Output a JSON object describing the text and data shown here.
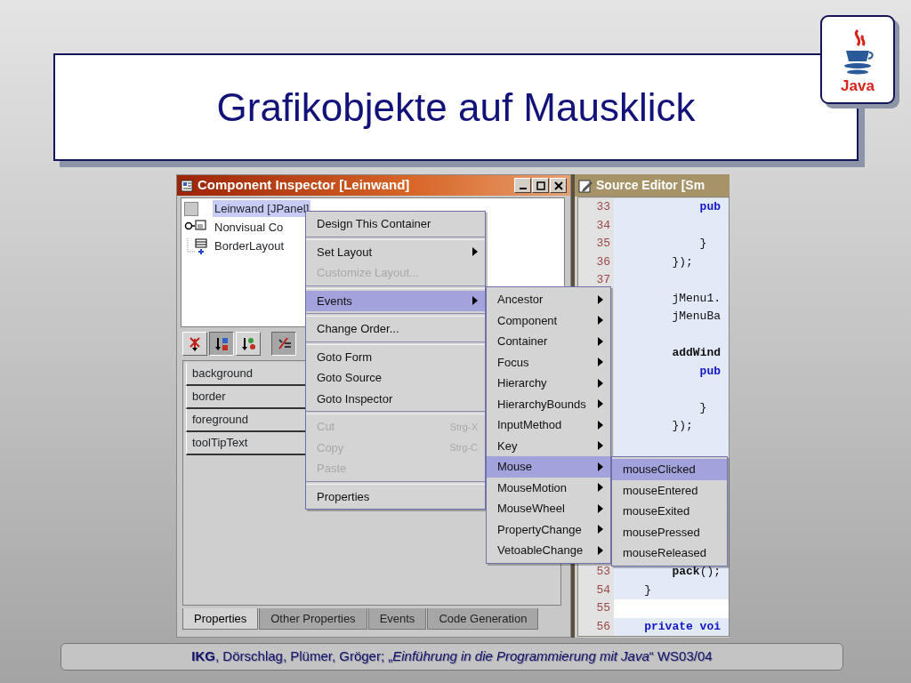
{
  "slide": {
    "title": "Grafikobjekte auf Mausklick",
    "logo_text": "Java",
    "footer": "**IKG**, Dörschlag, Plümer, Gröger; „*Einführung in die Programmierung mit Java*“ WS03/04"
  },
  "inspector": {
    "title": "Component Inspector [Leinwand]",
    "tree": [
      {
        "label": "Leinwand [JPanel]",
        "selected": true,
        "children": [
          {
            "label": "Nonvisual Co",
            "selected": false,
            "kind": "nonvisual"
          },
          {
            "label": "BorderLayout",
            "selected": false,
            "kind": "layout"
          }
        ]
      }
    ],
    "toolbar": [
      {
        "kind": "unsorted",
        "pressed": false
      },
      {
        "kind": "sort-name",
        "pressed": true
      },
      {
        "kind": "sort-type",
        "pressed": false
      },
      {
        "kind": "filter",
        "pressed": true
      }
    ],
    "properties": [
      "background",
      "border",
      "foreground",
      "toolTipText"
    ],
    "tabs": [
      {
        "label": "Properties",
        "selected": true
      },
      {
        "label": "Other Properties",
        "selected": false
      },
      {
        "label": "Events",
        "selected": false
      },
      {
        "label": "Code Generation",
        "selected": false
      }
    ]
  },
  "editor": {
    "title": "Source Editor [Sm",
    "lines": [
      {
        "number": "33",
        "code": "            pub",
        "kind": "keyword",
        "highlighted": true
      },
      {
        "number": "34",
        "highlighted": true
      },
      {
        "number": "35",
        "code": "            }",
        "highlighted": true
      },
      {
        "number": "36",
        "code": "        });",
        "highlighted": true
      },
      {
        "number": "37",
        "highlighted": true
      },
      {
        "code": "        jMenu1.",
        "highlighted": true
      },
      {
        "code": "        jMenuBa",
        "highlighted": true
      },
      {
        "highlighted": true
      },
      {
        "code": "        **addWind**",
        "highlighted": true
      },
      {
        "code": "            pub",
        "kind": "keyword",
        "highlighted": true
      },
      {
        "highlighted": true
      },
      {
        "code": "            }",
        "highlighted": true
      },
      {
        "code": "        });",
        "highlighted": true
      },
      {
        "highlighted": true
      },
      {
        "highlighted": true
      },
      {
        "highlighted": true
      },
      {
        "highlighted": true
      },
      {
        "highlighted": true
      },
      {
        "highlighted": true
      },
      {
        "highlighted": true
      },
      {
        "number": "53",
        "code": "        **pack**();",
        "highlighted": true
      },
      {
        "number": "54",
        "code": "    }",
        "highlighted": true
      },
      {
        "number": "55",
        "highlighted": false
      },
      {
        "number": "56",
        "code": "    private voi",
        "kind": "keyword",
        "highlighted": true
      }
    ]
  },
  "context_menu": {
    "items": [
      {
        "kind": "item",
        "label": "Design This Container",
        "disabled": false,
        "submenu": false,
        "selected": false
      },
      {
        "kind": "separator"
      },
      {
        "kind": "item",
        "label": "Set Layout",
        "disabled": false,
        "submenu": true,
        "selected": false
      },
      {
        "kind": "item",
        "label": "Customize Layout...",
        "disabled": true,
        "submenu": false,
        "selected": false
      },
      {
        "kind": "separator"
      },
      {
        "kind": "item",
        "label": "Events",
        "disabled": false,
        "submenu": true,
        "selected": true
      },
      {
        "kind": "separator"
      },
      {
        "kind": "item",
        "label": "Change Order...",
        "disabled": false,
        "submenu": false,
        "selected": false
      },
      {
        "kind": "separator"
      },
      {
        "kind": "item",
        "label": "Goto Form",
        "disabled": false,
        "submenu": false,
        "selected": false
      },
      {
        "kind": "item",
        "label": "Goto Source",
        "disabled": false,
        "submenu": false,
        "selected": false
      },
      {
        "kind": "item",
        "label": "Goto Inspector",
        "disabled": false,
        "submenu": false,
        "selected": false
      },
      {
        "kind": "separator"
      },
      {
        "kind": "item",
        "label": "Cut",
        "shortcut": "Strg-X",
        "disabled": true,
        "submenu": false,
        "selected": false
      },
      {
        "kind": "item",
        "label": "Copy",
        "shortcut": "Strg-C",
        "disabled": true,
        "submenu": false,
        "selected": false
      },
      {
        "kind": "item",
        "label": "Paste",
        "disabled": true,
        "submenu": false,
        "selected": false
      },
      {
        "kind": "separator"
      },
      {
        "kind": "item",
        "label": "Properties",
        "disabled": false,
        "submenu": false,
        "selected": false
      }
    ]
  },
  "events_menu": {
    "items": [
      {
        "kind": "item",
        "label": "Ancestor",
        "submenu": true,
        "selected": false
      },
      {
        "kind": "item",
        "label": "Component",
        "submenu": true,
        "selected": false
      },
      {
        "kind": "item",
        "label": "Container",
        "submenu": true,
        "selected": false
      },
      {
        "kind": "item",
        "label": "Focus",
        "submenu": true,
        "selected": false
      },
      {
        "kind": "item",
        "label": "Hierarchy",
        "submenu": true,
        "selected": false
      },
      {
        "kind": "item",
        "label": "HierarchyBounds",
        "submenu": true,
        "selected": false
      },
      {
        "kind": "item",
        "label": "InputMethod",
        "submenu": true,
        "selected": false
      },
      {
        "kind": "item",
        "label": "Key",
        "submenu": true,
        "selected": false
      },
      {
        "kind": "item",
        "label": "Mouse",
        "submenu": true,
        "selected": true
      },
      {
        "kind": "item",
        "label": "MouseMotion",
        "submenu": true,
        "selected": false
      },
      {
        "kind": "item",
        "label": "MouseWheel",
        "submenu": true,
        "selected": false
      },
      {
        "kind": "item",
        "label": "PropertyChange",
        "submenu": true,
        "selected": false
      },
      {
        "kind": "item",
        "label": "VetoableChange",
        "submenu": true,
        "selected": false
      }
    ]
  },
  "mouse_menu": {
    "items": [
      {
        "kind": "item",
        "label": "mouseClicked",
        "submenu": false,
        "selected": true
      },
      {
        "kind": "item",
        "label": "mouseEntered",
        "submenu": false,
        "selected": false
      },
      {
        "kind": "item",
        "label": "mouseExited",
        "submenu": false,
        "selected": false
      },
      {
        "kind": "item",
        "label": "mousePressed",
        "submenu": false,
        "selected": false
      },
      {
        "kind": "item",
        "label": "mouseReleased",
        "submenu": false,
        "selected": false
      }
    ]
  }
}
